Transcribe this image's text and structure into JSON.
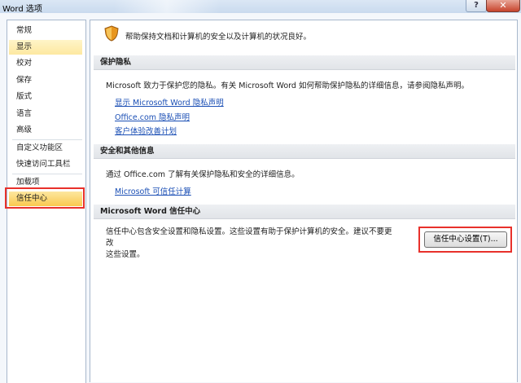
{
  "window": {
    "title": "Word 选项",
    "help_label": "?",
    "close_label": "✕"
  },
  "sidebar": {
    "items": [
      {
        "label": "常规"
      },
      {
        "label": "显示"
      },
      {
        "label": "校对"
      },
      {
        "label": "保存"
      },
      {
        "label": "版式"
      },
      {
        "label": "语言"
      },
      {
        "label": "高级"
      },
      {
        "label": "自定义功能区"
      },
      {
        "label": "快速访问工具栏"
      },
      {
        "label": "加载项"
      },
      {
        "label": "信任中心"
      }
    ],
    "selected": "信任中心",
    "hovered": "显示"
  },
  "main": {
    "intro": "帮助保持文档和计算机的安全以及计算机的状况良好。",
    "privacy": {
      "header": "保护隐私",
      "text": "Microsoft 致力于保护您的隐私。有关 Microsoft Word 如何帮助保护隐私的详细信息，请参阅隐私声明。",
      "links": [
        "显示 Microsoft Word 隐私声明",
        "Office.com 隐私声明",
        "客户体验改善计划"
      ]
    },
    "security": {
      "header": "安全和其他信息",
      "text": "通过 Office.com 了解有关保护隐私和安全的详细信息。",
      "link": "Microsoft 可信任计算"
    },
    "trust_center": {
      "header": "Microsoft Word 信任中心",
      "text_line1": "信任中心包含安全设置和隐私设置。这些设置有助于保护计算机的安全。建议不要更改",
      "text_line2": "这些设置。",
      "button_label": "信任中心设置(T)..."
    }
  },
  "colors": {
    "accent_selected": "#f9c84f",
    "highlight_box": "#e8312b",
    "link": "#1b4fb5"
  },
  "icons": {
    "help": "help-icon",
    "close": "close-icon",
    "shield": "shield-icon"
  }
}
